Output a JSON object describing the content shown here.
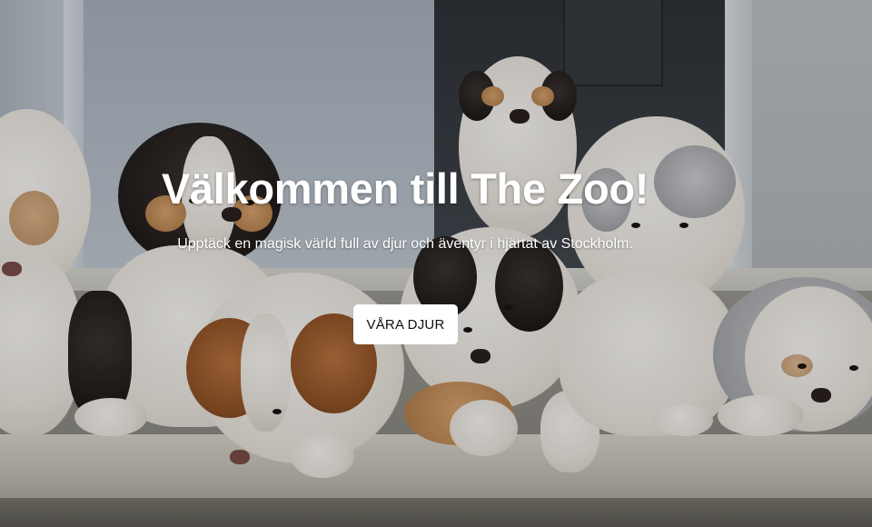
{
  "hero": {
    "title": "Välkommen till The Zoo!",
    "subtitle": "Upptäck en magisk värld full av djur och äventyr i hjärtat av Stockholm.",
    "cta_label": "VÅRA DJUR",
    "background_image": "puppies-on-doorstep-photo"
  },
  "colors": {
    "title_text": "#ffffff",
    "button_bg": "#ffffff",
    "button_text": "#111111"
  }
}
